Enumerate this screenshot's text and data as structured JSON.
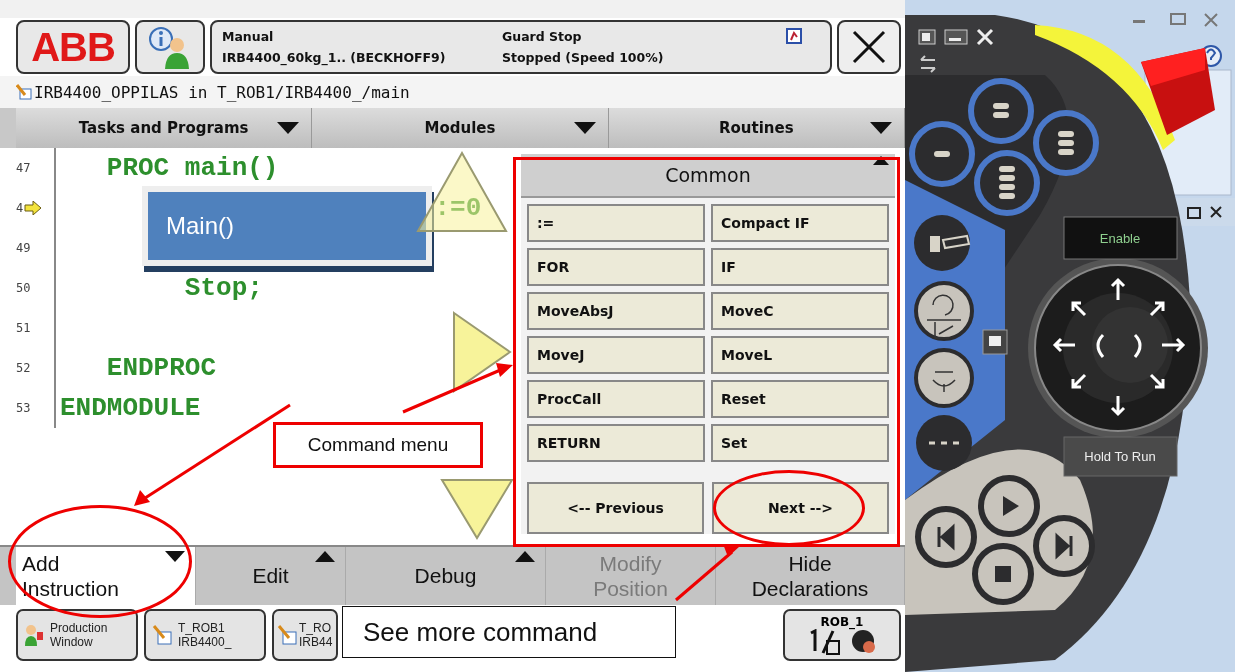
{
  "logo": "ABB",
  "status": {
    "mode": "Manual",
    "controller": "IRB4400_60kg_1.. (BECKHOFF9)",
    "safety": "Guard Stop",
    "run_state": "Stopped (Speed 100%)"
  },
  "path": "IRB4400_OPPILAS in T_ROB1/IRB4400_/main",
  "nav_tabs": [
    {
      "label": "Tasks and Programs"
    },
    {
      "label": "Modules"
    },
    {
      "label": "Routines"
    }
  ],
  "code_lines": [
    {
      "number": "47",
      "text": "   PROC main()",
      "pointer": false
    },
    {
      "number": "4",
      "text": "                        :=0",
      "pointer": true
    },
    {
      "number": "49",
      "pointer": false
    },
    {
      "number": "50",
      "text": "        Stop;",
      "pointer": false
    },
    {
      "number": "51",
      "pointer": false
    },
    {
      "number": "52",
      "text": "   ENDPROC",
      "pointer": false
    },
    {
      "number": "53",
      "text": "ENDMODULE",
      "pointer": false
    }
  ],
  "popup": {
    "text": "Main()"
  },
  "command_menu": {
    "title": "Common",
    "items": [
      ":=",
      "Compact IF",
      "FOR",
      "IF",
      "MoveAbsJ",
      "MoveC",
      "MoveJ",
      "MoveL",
      "ProcCall",
      "Reset",
      "RETURN",
      "Set"
    ],
    "previous": "<-- Previous",
    "next": "Next -->"
  },
  "bottom_menu": [
    {
      "lines": [
        "Add",
        "Instruction"
      ],
      "kind": "dropdown",
      "selected": true,
      "disabled": false
    },
    {
      "lines": [
        "Edit"
      ],
      "kind": "dropup",
      "selected": false,
      "disabled": false
    },
    {
      "lines": [
        "Debug"
      ],
      "kind": "dropup",
      "selected": false,
      "disabled": false
    },
    {
      "lines": [
        "Modify",
        "Position"
      ],
      "kind": "plain",
      "selected": false,
      "disabled": true
    },
    {
      "lines": [
        "Hide",
        "Declarations"
      ],
      "kind": "plain",
      "selected": false,
      "disabled": false
    }
  ],
  "taskbar": [
    {
      "kind": "window",
      "lines": [
        "Production",
        "Window"
      ]
    },
    {
      "kind": "task",
      "lines": [
        "T_ROB1",
        "IRB4400_"
      ]
    },
    {
      "kind": "task",
      "lines": [
        "T_RO",
        "IRB44"
      ]
    }
  ],
  "robot_status": {
    "label": "ROB_1"
  },
  "pendant": {
    "enable": "Enable",
    "hold_to_run": "Hold To Run"
  },
  "annotations": [
    {
      "kind": "callout",
      "text": "Command menu"
    },
    {
      "kind": "callout",
      "text": "See more command"
    }
  ]
}
